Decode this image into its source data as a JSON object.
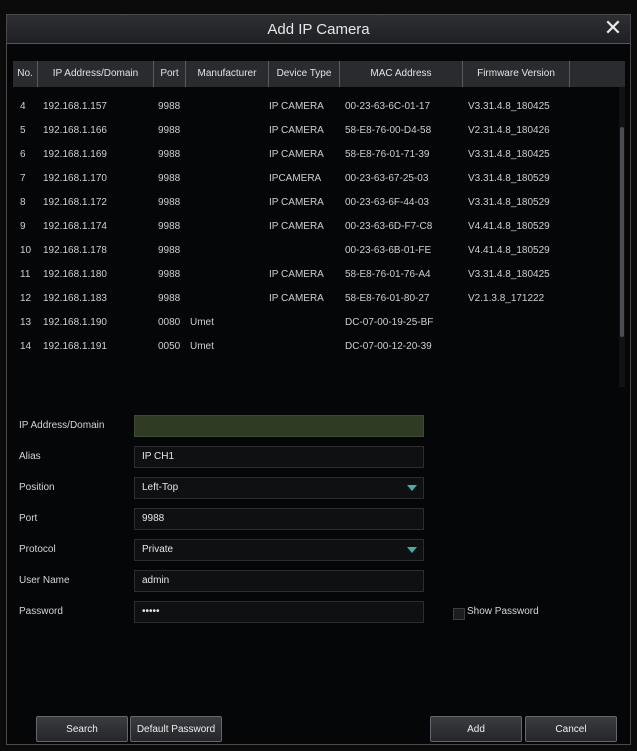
{
  "dialog": {
    "title": "Add IP Camera",
    "close_symbol": "✕"
  },
  "table": {
    "columns": [
      "No.",
      "IP Address/Domain",
      "Port",
      "Manufacturer",
      "Device Type",
      "MAC Address",
      "Firmware Version"
    ],
    "rows": [
      {
        "no": "4",
        "ip": "192.168.1.157",
        "port": "9988",
        "manufacturer": "",
        "type": "IP CAMERA",
        "mac": "00-23-63-6C-01-17",
        "firmware": "V3.31.4.8_180425"
      },
      {
        "no": "5",
        "ip": "192.168.1.166",
        "port": "9988",
        "manufacturer": "",
        "type": "IP CAMERA",
        "mac": "58-E8-76-00-D4-58",
        "firmware": "V2.31.4.8_180426"
      },
      {
        "no": "6",
        "ip": "192.168.1.169",
        "port": "9988",
        "manufacturer": "",
        "type": "IP CAMERA",
        "mac": "58-E8-76-01-71-39",
        "firmware": "V3.31.4.8_180425"
      },
      {
        "no": "7",
        "ip": "192.168.1.170",
        "port": "9988",
        "manufacturer": "",
        "type": "IPCAMERA",
        "mac": "00-23-63-67-25-03",
        "firmware": "V3.31.4.8_180529"
      },
      {
        "no": "8",
        "ip": "192.168.1.172",
        "port": "9988",
        "manufacturer": "",
        "type": "IP CAMERA",
        "mac": "00-23-63-6F-44-03",
        "firmware": "V3.31.4.8_180529"
      },
      {
        "no": "9",
        "ip": "192.168.1.174",
        "port": "9988",
        "manufacturer": "",
        "type": "IP CAMERA",
        "mac": "00-23-63-6D-F7-C8",
        "firmware": "V4.41.4.8_180529"
      },
      {
        "no": "10",
        "ip": "192.168.1.178",
        "port": "9988",
        "manufacturer": "",
        "type": "",
        "mac": "00-23-63-6B-01-FE",
        "firmware": "V4.41.4.8_180529"
      },
      {
        "no": "11",
        "ip": "192.168.1.180",
        "port": "9988",
        "manufacturer": "",
        "type": "IP CAMERA",
        "mac": "58-E8-76-01-76-A4",
        "firmware": "V3.31.4.8_180425"
      },
      {
        "no": "12",
        "ip": "192.168.1.183",
        "port": "9988",
        "manufacturer": "",
        "type": "IP CAMERA",
        "mac": "58-E8-76-01-80-27",
        "firmware": "V2.1.3.8_171222"
      },
      {
        "no": "13",
        "ip": "192.168.1.190",
        "port": "0080",
        "manufacturer": "Umet",
        "type": "",
        "mac": "DC-07-00-19-25-BF",
        "firmware": ""
      },
      {
        "no": "14",
        "ip": "192.168.1.191",
        "port": "0050",
        "manufacturer": "Umet",
        "type": "",
        "mac": "DC-07-00-12-20-39",
        "firmware": ""
      }
    ]
  },
  "form": {
    "ip_label": "IP Address/Domain",
    "ip_value": "",
    "alias_label": "Alias",
    "alias_value": "IP CH1",
    "position_label": "Position",
    "position_value": "Left-Top",
    "port_label": "Port",
    "port_value": "9988",
    "protocol_label": "Protocol",
    "protocol_value": "Private",
    "username_label": "User Name",
    "username_value": "admin",
    "password_label": "Password",
    "password_value": "•••••",
    "show_password_label": "Show Password"
  },
  "buttons": {
    "search": "Search",
    "default_password": "Default Password",
    "add": "Add",
    "cancel": "Cancel"
  },
  "colors": {
    "ip_field_bg": "#2f3b22",
    "accent_arrow": "#3fb0a2"
  }
}
